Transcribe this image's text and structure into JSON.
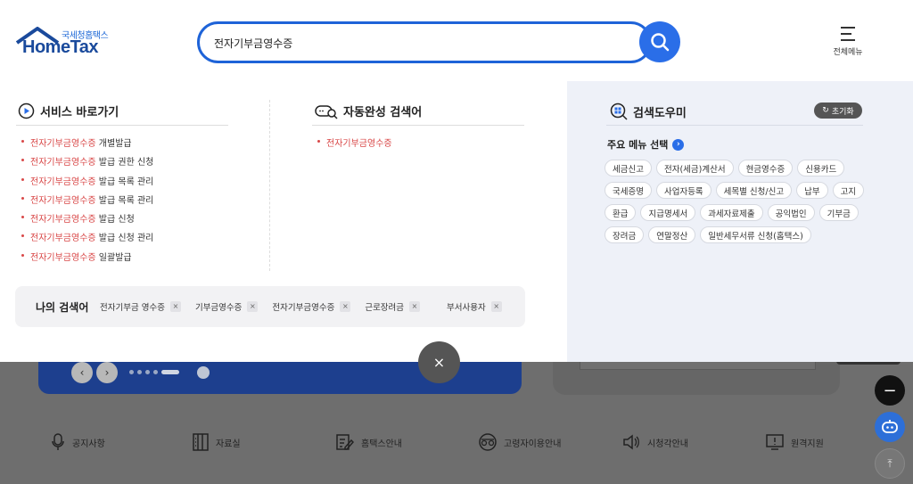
{
  "header": {
    "logo_sub": "국세청홈택스",
    "logo_main": "HomeTax",
    "search_value": "전자기부금영수증",
    "full_menu_label": "전체메뉴"
  },
  "service_shortcut": {
    "title": "서비스 바로가기",
    "items": [
      {
        "highlight": "전자기부금영수증",
        "rest": " 개별발급"
      },
      {
        "highlight": "전자기부금영수증",
        "rest": " 발급 권한 신청"
      },
      {
        "highlight": "전자기부금영수증",
        "rest": " 발급 목록 관리"
      },
      {
        "highlight": "전자기부금영수증",
        "rest": " 발급 목록 관리"
      },
      {
        "highlight": "전자기부금영수증",
        "rest": " 발급 신청"
      },
      {
        "highlight": "전자기부금영수증",
        "rest": " 발급 신청 관리"
      },
      {
        "highlight": "전자기부금영수증",
        "rest": " 일괄발급"
      }
    ]
  },
  "autocomplete": {
    "title": "자동완성 검색어",
    "items": [
      "전자기부금영수증"
    ]
  },
  "recent": {
    "title": "나의 검색어",
    "items": [
      "전자기부금 영수증",
      "기부금영수증",
      "전자기부금영수증",
      "근로장려금",
      "부서사용자"
    ],
    "remove_label": "×"
  },
  "helper": {
    "title": "검색도우미",
    "reset_label": "초기화",
    "menu_select_label": "주요 메뉴 선택",
    "tags": [
      [
        "세금신고",
        "전자(세금)계산서",
        "현금영수증",
        "신용카드"
      ],
      [
        "국세증명",
        "사업자등록",
        "세목별 신청/신고",
        "납부",
        "고지"
      ],
      [
        "환급",
        "지급명세서",
        "과세자료제출",
        "공익법인",
        "기부금"
      ],
      [
        "장려금",
        "연말정산",
        "일반세무서류 신청(홈택스)"
      ]
    ]
  },
  "close_label": "×",
  "shortcuts": [
    {
      "label": "공지사항",
      "icon": "microphone-icon"
    },
    {
      "label": "자료실",
      "icon": "binder-icon"
    },
    {
      "label": "홈택스안내",
      "icon": "document-edit-icon"
    },
    {
      "label": "고령자이용안내",
      "icon": "glasses-icon"
    },
    {
      "label": "시청각안내",
      "icon": "speaker-icon"
    },
    {
      "label": "원격지원",
      "icon": "monitor-alert-icon"
    }
  ],
  "colors": {
    "accent": "#2a6ee8",
    "highlight": "#d94848",
    "banner": "#1d3f8e"
  }
}
